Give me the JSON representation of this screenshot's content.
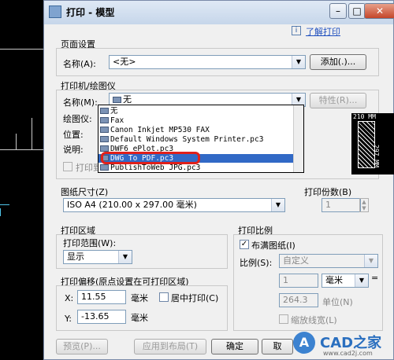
{
  "window": {
    "title": "打印 - 模型"
  },
  "help_link": "了解打印",
  "page_setup": {
    "section_label": "页面设置",
    "name_label": "名称(A):",
    "name_value": "<无>",
    "add_button": "添加(.)..."
  },
  "printer": {
    "section_label": "打印机/绘图仪",
    "name_label": "名称(M):",
    "name_value": "无",
    "properties_button": "特性(R)...",
    "plotter_label": "绘图仪:",
    "location_label": "位置:",
    "description_label": "说明:",
    "print_to_file_label": "打印到文件",
    "dropdown_items": [
      "无",
      "Fax",
      "Canon Inkjet MP530 FAX",
      "Default Windows System Printer.pc3",
      "DWF6 ePlot.pc3",
      "DWG To PDF.pc3",
      "PublishToWeb JPG.pc3"
    ],
    "preview_width": "210 MM",
    "preview_height": "297 MM"
  },
  "paper_size": {
    "section_label": "图纸尺寸(Z)",
    "value": "ISO A4 (210.00 x 297.00 毫米)"
  },
  "copies": {
    "section_label": "打印份数(B)",
    "value": "1"
  },
  "print_area": {
    "section_label": "打印区域",
    "range_label": "打印范围(W):",
    "range_value": "显示"
  },
  "scale": {
    "section_label": "打印比例",
    "fit_paper_label": "布满图纸(I)",
    "fit_paper_checked": true,
    "scale_label": "比例(S):",
    "scale_value": "自定义",
    "value1": "1",
    "unit_value": "毫米",
    "value2": "264.3",
    "unit_label": "单位(N)",
    "lineweight_label": "缩放线宽(L)"
  },
  "offset": {
    "section_label": "打印偏移(原点设置在可打印区域)",
    "x_label": "X:",
    "x_value": "11.55",
    "x_unit": "毫米",
    "y_label": "Y:",
    "y_value": "-13.65",
    "y_unit": "毫米",
    "center_label": "居中打印(C)"
  },
  "buttons": {
    "preview": "预览(P)...",
    "apply": "应用到布局(T)",
    "ok": "确定",
    "cancel": "取"
  },
  "watermark": {
    "site": "www.cad2j.com",
    "brand": "CAD之家"
  }
}
